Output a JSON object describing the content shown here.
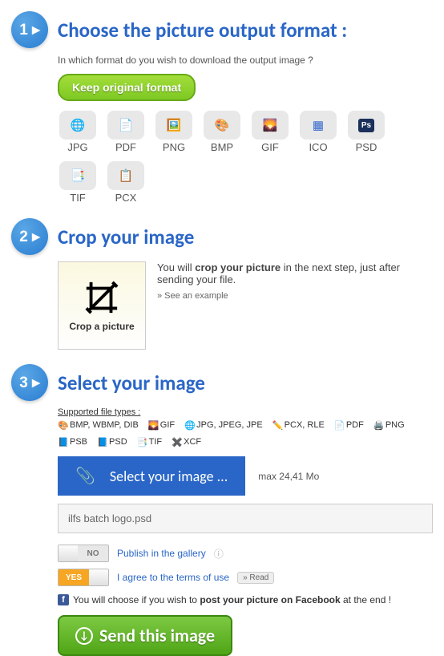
{
  "steps": {
    "s1": {
      "num": "1 ▸",
      "title": "Choose the picture output format :"
    },
    "s2": {
      "num": "2 ▸",
      "title": "Crop your image"
    },
    "s3": {
      "num": "3 ▸",
      "title": "Select your image"
    }
  },
  "s1": {
    "question": "In which format do you wish to download the output image ?",
    "keep_btn": "Keep original format",
    "formats": {
      "jpg": "JPG",
      "pdf": "PDF",
      "png": "PNG",
      "bmp": "BMP",
      "gif": "GIF",
      "ico": "ICO",
      "psd": "PSD",
      "tif": "TIF",
      "pcx": "PCX"
    }
  },
  "s2": {
    "desc_pre": "You will ",
    "desc_bold": "crop your picture",
    "desc_post": " in the next step, just after sending your file.",
    "see_example": "» See an example",
    "thumb_text": "Crop a picture"
  },
  "s3": {
    "supported_title": "Supported file types :",
    "supported": {
      "bmp": "BMP, WBMP, DIB",
      "gif": "GIF",
      "jpg": "JPG, JPEG, JPE",
      "pcx": "PCX, RLE",
      "pdf": "PDF",
      "png": "PNG",
      "psb": "PSB",
      "psd": "PSD",
      "tif": "TIF",
      "xcf": "XCF"
    },
    "select_btn": "Select your image ...",
    "max": "max 24,41 Mo",
    "filename": "ilfs batch logo.psd",
    "toggle_no": "NO",
    "toggle_yes": "YES",
    "publish_text": "Publish in the gallery",
    "agree_text": "I agree to the terms of use",
    "read_btn": "» Read",
    "fb_pre": "You will choose if you wish to ",
    "fb_bold": "post your picture on Facebook",
    "fb_post": " at the end !",
    "send_btn": "Send this image"
  }
}
